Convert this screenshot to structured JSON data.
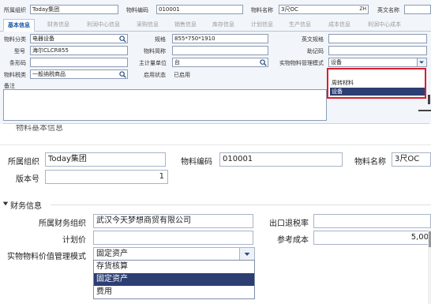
{
  "top_form": {
    "header": {
      "org_label": "所属组织",
      "org_value": "Today集团",
      "code_label": "物料编码",
      "code_value": "010001",
      "name_label": "物料名称",
      "name_value": "3尺OC",
      "lang_badge": "ZH",
      "en_name_label": "英文名称"
    },
    "tabs": [
      "基本信息",
      "财务信息",
      "利润中心信息",
      "采购信息",
      "销售信息",
      "库存信息",
      "计划信息",
      "生产信息",
      "成本信息",
      "利润中心成本"
    ],
    "fields": {
      "category_label": "物料分类",
      "category_value": "电器设备",
      "spec_label": "规格",
      "spec_value": "855*750*1910",
      "en_spec_label": "英文规格",
      "model_label": "型号",
      "model_value": "海尔CLCR855",
      "abbr_label": "物料简称",
      "mnemonic_label": "助记码",
      "barcode_label": "条形码",
      "unit_label": "主计量单位",
      "unit_value": "台",
      "mgmt_mode_label": "实物物料管理模式",
      "mgmt_mode_value": "设备",
      "tax_label": "物料税类",
      "tax_value": "一般纳税商品",
      "enable_label": "启用状态",
      "enable_value": "已启用",
      "remark_label": "备注"
    },
    "dropdown_options": [
      "周转材料",
      "设备"
    ],
    "dropdown_selected": "设备"
  },
  "bottom_form": {
    "partial_header": "物料基本信息",
    "org_label": "所属组织",
    "org_value": "Today集团",
    "code_label": "物料编码",
    "code_value": "010001",
    "name_label": "物料名称",
    "name_value": "3尺OC",
    "version_label": "版本号",
    "version_value": "1",
    "finance_section": "财务信息",
    "fin_org_label": "所属财务组织",
    "fin_org_value": "武汉今天梦想商贸有限公司",
    "export_rebate_label": "出口退税率",
    "plan_price_label": "计划价",
    "ref_cost_label": "参考成本",
    "ref_cost_value": "5,00",
    "valuation_label": "实物物料价值管理模式",
    "valuation_value": "固定资产",
    "dropdown_options": [
      "存货核算",
      "固定资产",
      "费用"
    ],
    "dropdown_selected": "固定资产"
  },
  "colors": {
    "accent": "#1a57a8",
    "selected_bg": "#2c3e72",
    "highlight_border": "#d81e2b"
  }
}
